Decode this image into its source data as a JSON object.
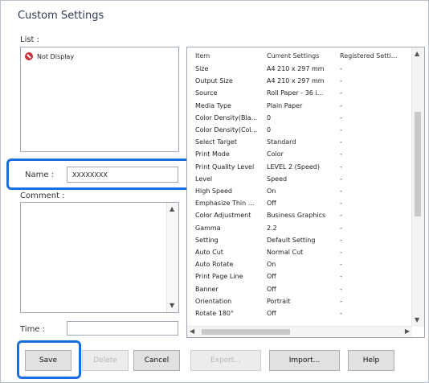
{
  "window": {
    "title": "Custom Settings"
  },
  "labels": {
    "list": "List :",
    "name": "Name :",
    "comment": "Comment :",
    "time": "Time :"
  },
  "list": {
    "items": [
      {
        "label": "Not Display",
        "icon": "not-display-icon"
      }
    ]
  },
  "name_field": {
    "value": "XXXXXXXX"
  },
  "comment_field": {
    "value": ""
  },
  "time_field": {
    "value": ""
  },
  "grid": {
    "columns": [
      "Item",
      "Current Settings",
      "Registered Setti..."
    ],
    "rows": [
      [
        "Size",
        "A4 210 x 297 mm",
        "-"
      ],
      [
        "Output Size",
        "A4 210 x 297 mm",
        "-"
      ],
      [
        "Source",
        "Roll Paper - 36 i...",
        "-"
      ],
      [
        "Media Type",
        "Plain Paper",
        "-"
      ],
      [
        "Color Density(Bla...",
        "0",
        "-"
      ],
      [
        "Color Density(Col...",
        "0",
        "-"
      ],
      [
        "Select Target",
        "Standard",
        "-"
      ],
      [
        "Print Mode",
        "Color",
        "-"
      ],
      [
        "Print Quality Level",
        "LEVEL 2 (Speed)",
        "-"
      ],
      [
        "Level",
        "Speed",
        "-"
      ],
      [
        "High Speed",
        "On",
        "-"
      ],
      [
        "Emphasize Thin ...",
        "Off",
        "-"
      ],
      [
        "Color Adjustment",
        "Business Graphics",
        "-"
      ],
      [
        "Gamma",
        "2.2",
        "-"
      ],
      [
        "Setting",
        "Default Setting",
        "-"
      ],
      [
        "Auto Cut",
        "Normal Cut",
        "-"
      ],
      [
        "Auto Rotate",
        "On",
        "-"
      ],
      [
        "Print Page Line",
        "Off",
        "-"
      ],
      [
        "Banner",
        "Off",
        "-"
      ],
      [
        "Orientation",
        "Portrait",
        "-"
      ],
      [
        "Rotate 180°",
        "Off",
        "-"
      ]
    ]
  },
  "buttons": {
    "save": "Save",
    "delete": "Delete",
    "cancel": "Cancel",
    "export": "Export...",
    "import": "Import...",
    "help": "Help"
  },
  "colors": {
    "highlight": "#1a6ee0",
    "not_display_icon": "#c8313a"
  }
}
